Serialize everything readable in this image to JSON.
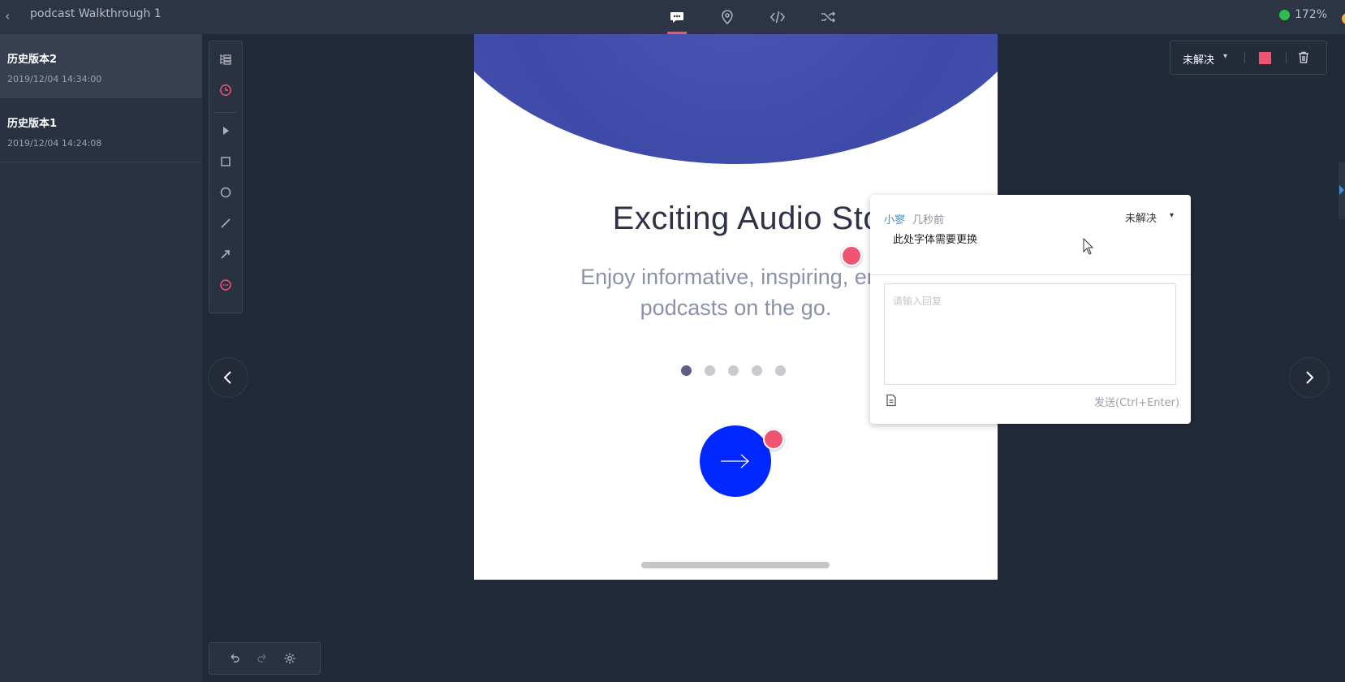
{
  "header": {
    "back_icon": "chevron-left-icon",
    "title": "podcast Walkthrough 1",
    "nav": [
      {
        "name": "comment",
        "icon": "comment-icon",
        "active": true
      },
      {
        "name": "location",
        "icon": "map-pin-icon",
        "active": false
      },
      {
        "name": "code",
        "icon": "code-icon",
        "active": false
      },
      {
        "name": "shuffle",
        "icon": "shuffle-icon",
        "active": false
      }
    ],
    "zoom": "172%"
  },
  "history": {
    "items": [
      {
        "name": "历史版本2",
        "time": "2019/12/04 14:34:00",
        "active": true
      },
      {
        "name": "历史版本1",
        "time": "2019/12/04 14:24:08",
        "active": false
      }
    ]
  },
  "tools": [
    "layers-icon",
    "history-icon",
    "pointer-icon",
    "rectangle-icon",
    "circle-icon",
    "line-icon",
    "arrow-icon",
    "comment-tool-icon"
  ],
  "bottom_tools": [
    "undo-icon",
    "redo-icon",
    "settings-icon"
  ],
  "artboard": {
    "title": "Exciting Audio Stori",
    "subtitle_line1": "Enjoy informative, inspiring, eng",
    "subtitle_line2": "podcasts on the go.",
    "pager_count": 5,
    "pager_active_index": 0
  },
  "status_box": {
    "label": "未解决",
    "color": "#f05473"
  },
  "comment": {
    "user": "小寥",
    "time": "几秒前",
    "status": "未解决",
    "text": "此处字体需要更换",
    "reply_placeholder": "请输入回复",
    "send_label": "发送(Ctrl+Enter)"
  },
  "colors": {
    "accent": "#f05473",
    "button_blue": "#0027ff",
    "link_blue": "#3a8fde"
  }
}
